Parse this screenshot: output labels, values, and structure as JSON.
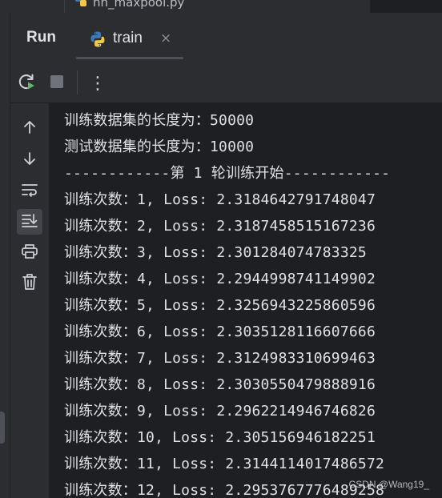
{
  "top_strip": {
    "file_name": "nn_maxpool.py"
  },
  "header": {
    "title": "Run",
    "tab": {
      "label": "train",
      "close_glyph": "×",
      "icon": "python-icon"
    }
  },
  "toolbar": {
    "rerun_icon": "rerun-icon",
    "stop_icon": "stop-icon",
    "more_icon": "more-vertical-icon",
    "more_glyph": "⋮"
  },
  "side_toolbar": {
    "items": [
      {
        "icon": "arrow-up-icon"
      },
      {
        "icon": "arrow-down-icon"
      },
      {
        "icon": "soft-wrap-icon"
      },
      {
        "icon": "scroll-to-end-icon",
        "active": true
      },
      {
        "icon": "print-icon"
      },
      {
        "icon": "trash-icon"
      }
    ]
  },
  "console": {
    "lines": [
      "训练数据集的长度为：50000",
      "测试数据集的长度为：10000",
      "------------第 1 轮训练开始------------",
      "训练次数：1, Loss: 2.3184642791748047",
      "训练次数：2, Loss: 2.3187458515167236",
      "训练次数：3, Loss: 2.301284074783325",
      "训练次数：4, Loss: 2.2944998741149902",
      "训练次数：5, Loss: 2.3256943225860596",
      "训练次数：6, Loss: 2.3035128116607666",
      "训练次数：7, Loss: 2.3124983310699463",
      "训练次数：8, Loss: 2.3030550479888916",
      "训练次数：9, Loss: 2.2962214946746826",
      "训练次数：10, Loss: 2.305156946182251",
      "训练次数：11, Loss: 2.3144114017486572",
      "训练次数：12, Loss: 2.2953767776489258"
    ]
  },
  "watermark": "CSDN @Wang19_",
  "colors": {
    "panel_bg": "#2b2d30",
    "console_bg": "#1e1f22",
    "text": "#dfe1e5",
    "rerun_green": "#5fb865",
    "python_blue": "#3d7ab8",
    "python_yellow": "#f5c842"
  }
}
